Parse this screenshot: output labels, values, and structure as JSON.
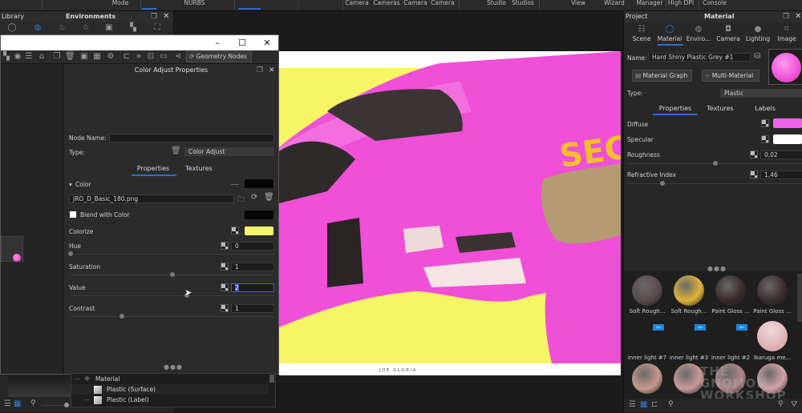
{
  "ribbon": {
    "items": [
      "Mode",
      "NURBS",
      "Camera",
      "Cameras",
      "Camera",
      "Camera",
      "Studio",
      "Studios",
      "View",
      "Wizard",
      "Manager",
      "High DPI",
      "Console"
    ]
  },
  "library": {
    "header_left": "Library",
    "header_center": "Environments",
    "icons": [
      "material-icon",
      "environment-icon",
      "colors-icon",
      "favorites-icon",
      "backplate-icon",
      "textures-icon",
      "models-icon"
    ]
  },
  "graph_window": {
    "toolbar_button": "Geometry Nodes"
  },
  "color_adjust": {
    "title": "Color Adjust Properties",
    "node_name_label": "Node Name:",
    "node_name_value": "",
    "type_label": "Type:",
    "type_value": "Color Adjust",
    "tabs": [
      "Properties",
      "Textures"
    ],
    "active_tab": "Properties",
    "color_section": "Color",
    "texture_file": "JRO_D_Basic_180.png",
    "blend_label": "Blend with Color",
    "blend_checked": false,
    "colorize_label": "Colorize",
    "colorize_color": "#f3f56a",
    "hue_label": "Hue",
    "hue_value": "0",
    "hue_slider": 0.0,
    "saturation_label": "Saturation",
    "saturation_value": "1",
    "saturation_slider": 0.5,
    "value_label": "Value",
    "value_value": "2",
    "value_slider": 0.57,
    "contrast_label": "Contrast",
    "contrast_value": "1",
    "contrast_slider": 0.25,
    "tree": [
      {
        "label": "Material",
        "level": 0
      },
      {
        "label": "Plastic (Surface)",
        "level": 1
      },
      {
        "label": "Plastic (Label)",
        "level": 1
      }
    ]
  },
  "viewport": {
    "render_credit": "JOE GLORIA",
    "decal_text": "SEC"
  },
  "right_panel": {
    "header_left": "Project",
    "header_center": "Material",
    "tabs": [
      {
        "label": "Scene",
        "icon": "scene-icon"
      },
      {
        "label": "Material",
        "icon": "material-icon"
      },
      {
        "label": "Enviro...",
        "icon": "environment-icon"
      },
      {
        "label": "Camera",
        "icon": "camera-icon"
      },
      {
        "label": "Lighting",
        "icon": "lighting-icon"
      },
      {
        "label": "Image",
        "icon": "image-icon"
      }
    ],
    "active_tab": "Material",
    "name_label": "Name:",
    "name_value": "Hard Shiny Plastic Grey #1",
    "material_graph_btn": "Material Graph",
    "multi_material_btn": "Multi-Material",
    "type_label": "Type:",
    "type_value": "Plastic",
    "sub_tabs": [
      "Properties",
      "Textures",
      "Labels"
    ],
    "active_sub_tab": "Properties",
    "diffuse_label": "Diffuse",
    "diffuse_color": "#f062e8",
    "specular_label": "Specular",
    "specular_color": "#ffffff",
    "roughness_label": "Roughness",
    "roughness_value": "0,02",
    "roughness_slider": 0.5,
    "refractive_label": "Refractive Index",
    "refractive_value": "1,46",
    "refractive_slider": 0.2,
    "materials": [
      {
        "name": "Soft Rough...",
        "color": "#5a4a4c"
      },
      {
        "name": "Soft Rough...",
        "color": "#e0b23a"
      },
      {
        "name": "Paint Gloss ...",
        "color": "#3a2a2a"
      },
      {
        "name": "Paint Gloss ...",
        "color": "#3c2c2e"
      },
      {
        "name": "inner light #7",
        "color": "#c79a8a"
      },
      {
        "name": "inner light #3",
        "color": "#c99a98"
      },
      {
        "name": "inner light #2",
        "color": "#b08888"
      },
      {
        "name": "Ikaruga me...",
        "color": "#d4a4a8"
      }
    ],
    "watermark": "THE GNOMON WORKSHOP"
  }
}
